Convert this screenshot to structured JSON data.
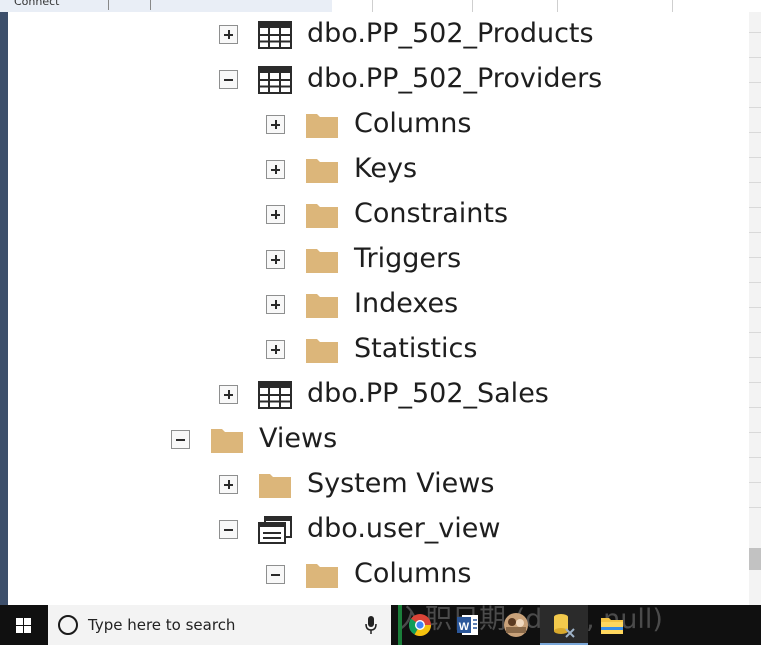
{
  "background": {
    "toolbar_text": "Connect"
  },
  "tree": {
    "nodes": [
      {
        "label": "dbo.PP_502_Products",
        "icon": "table-icon",
        "expanded": false
      },
      {
        "label": "dbo.PP_502_Providers",
        "icon": "table-icon",
        "expanded": true
      },
      {
        "label": "Columns",
        "icon": "folder-icon",
        "expanded": false
      },
      {
        "label": "Keys",
        "icon": "folder-icon",
        "expanded": false
      },
      {
        "label": "Constraints",
        "icon": "folder-icon",
        "expanded": false
      },
      {
        "label": "Triggers",
        "icon": "folder-icon",
        "expanded": false
      },
      {
        "label": "Indexes",
        "icon": "folder-icon",
        "expanded": false
      },
      {
        "label": "Statistics",
        "icon": "folder-icon",
        "expanded": false
      },
      {
        "label": "dbo.PP_502_Sales",
        "icon": "table-icon",
        "expanded": false
      },
      {
        "label": "Views",
        "icon": "folder-icon",
        "expanded": true
      },
      {
        "label": "System Views",
        "icon": "folder-icon",
        "expanded": false
      },
      {
        "label": "dbo.user_view",
        "icon": "view-icon",
        "expanded": true
      },
      {
        "label": "Columns",
        "icon": "folder-icon",
        "expanded": true
      }
    ]
  },
  "taskbar": {
    "search_placeholder": "Type here to search",
    "apps": [
      "chrome-icon",
      "word-icon",
      "photo-app-icon",
      "database-tool-icon",
      "file-explorer-icon"
    ],
    "overflow_text": "入职日期 (date, null)"
  },
  "colors": {
    "folder": "#dcb67a",
    "tree_text": "#1e1e1e",
    "taskbar": "#101010",
    "search_box": "#f3f3f3"
  }
}
